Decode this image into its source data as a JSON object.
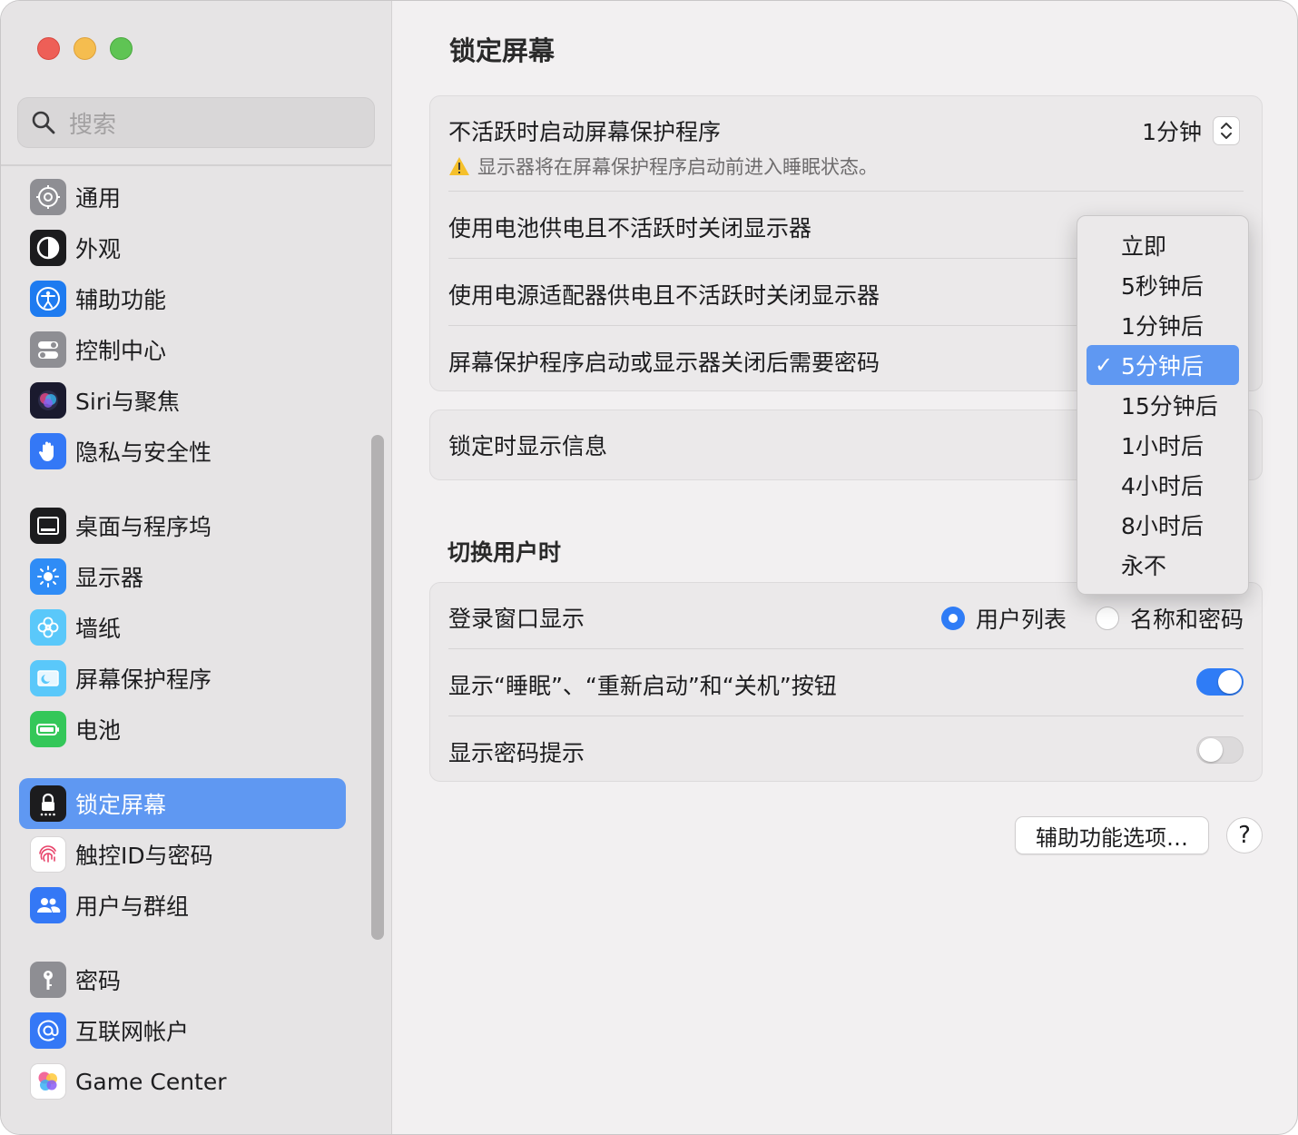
{
  "search": {
    "placeholder": "搜索"
  },
  "sidebar": {
    "items": [
      {
        "label": "通用",
        "icon": "gear-icon",
        "color": "#8e8e93"
      },
      {
        "label": "外观",
        "icon": "appearance-icon",
        "color": "#1c1c1e"
      },
      {
        "label": "辅助功能",
        "icon": "accessibility-icon",
        "color": "#1e7bf0"
      },
      {
        "label": "控制中心",
        "icon": "control-center-icon",
        "color": "#8e8e93"
      },
      {
        "label": "Siri与聚焦",
        "icon": "siri-icon",
        "color": "#1a1a2e"
      },
      {
        "label": "隐私与安全性",
        "icon": "hand-icon",
        "color": "#3478f6"
      },
      {
        "label": "桌面与程序坞",
        "icon": "dock-icon",
        "color": "#1c1c1e"
      },
      {
        "label": "显示器",
        "icon": "sun-icon",
        "color": "#2f8cf6"
      },
      {
        "label": "墙纸",
        "icon": "flower-icon",
        "color": "#5ac8fa"
      },
      {
        "label": "屏幕保护程序",
        "icon": "screensaver-icon",
        "color": "#5ac8fa"
      },
      {
        "label": "电池",
        "icon": "battery-icon",
        "color": "#34c759"
      },
      {
        "label": "锁定屏幕",
        "icon": "lock-icon",
        "color": "#1c1c1e"
      },
      {
        "label": "触控ID与密码",
        "icon": "fingerprint-icon",
        "color": "#ffffff"
      },
      {
        "label": "用户与群组",
        "icon": "users-icon",
        "color": "#3478f6"
      },
      {
        "label": "密码",
        "icon": "key-icon",
        "color": "#8e8e93"
      },
      {
        "label": "互联网帐户",
        "icon": "at-icon",
        "color": "#3478f6"
      },
      {
        "label": "Game Center",
        "icon": "game-center-icon",
        "color": "#ffffff"
      }
    ],
    "selected": "锁定屏幕"
  },
  "main": {
    "title": "锁定屏幕",
    "card1": {
      "screensaver_label": "不活跃时启动屏幕保护程序",
      "screensaver_value": "1分钟",
      "warning": "显示器将在屏幕保护程序启动前进入睡眠状态。",
      "battery_label": "使用电池供电且不活跃时关闭显示器",
      "adapter_label": "使用电源适配器供电且不活跃时关闭显示器",
      "password_label": "屏幕保护程序启动或显示器关闭后需要密码"
    },
    "card2": {
      "show_info_label": "锁定时显示信息"
    },
    "switch_section": {
      "title": "切换用户时",
      "login_label": "登录窗口显示",
      "option_list": "用户列表",
      "option_name_pw": "名称和密码",
      "selected_option": "用户列表",
      "buttons_label": "显示“睡眠”、“重新启动”和“关机”按钮",
      "buttons_toggle": true,
      "hint_label": "显示密码提示",
      "hint_toggle": false
    },
    "accessibility_button": "辅助功能选项…",
    "help_button": "?"
  },
  "dropdown": {
    "options": [
      "立即",
      "5秒钟后",
      "1分钟后",
      "5分钟后",
      "15分钟后",
      "1小时后",
      "4小时后",
      "8小时后",
      "永不"
    ],
    "selected": "5分钟后",
    "check": "✓"
  },
  "colors": {
    "accent": "#2f7cf6",
    "selection": "#5f98f2",
    "warning": "#f5c02b"
  }
}
